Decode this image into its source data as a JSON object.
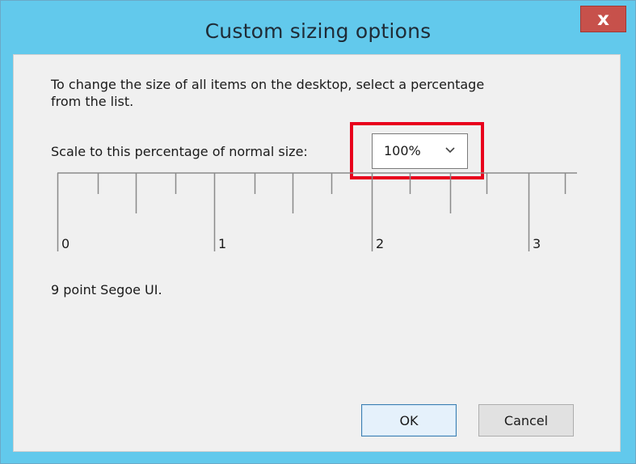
{
  "dialog": {
    "title": "Custom sizing options",
    "close_label": "x",
    "description": "To change the size of all items on the desktop, select a percentage from the list.",
    "scale_label": "Scale to this percentage of normal size:",
    "scale_select": {
      "selected": "100%",
      "chevron_icon": "chevron-down-icon"
    },
    "ruler": {
      "labels": [
        "0",
        "1",
        "2",
        "3"
      ]
    },
    "sample_text": "9 point Segoe UI.",
    "ok_label": "OK",
    "cancel_label": "Cancel",
    "colors": {
      "title_bar": "#62c9ec",
      "close_button": "#c7514b",
      "highlight": "#e8001c",
      "client_bg": "#f0f0f0"
    }
  }
}
